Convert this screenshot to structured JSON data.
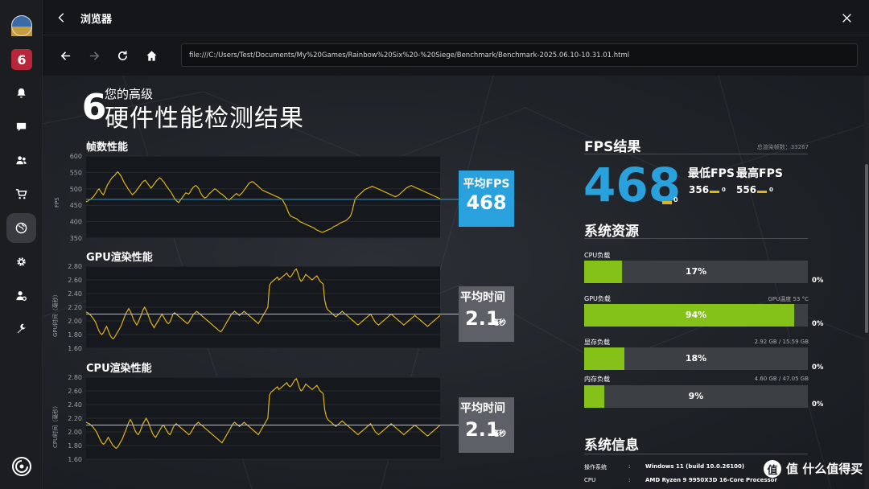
{
  "window": {
    "title": "浏览器",
    "url": "file:///C:/Users/Test/Documents/My%20Games/Rainbow%20Six%20-%20Siege/Benchmark/Benchmark-2025.06.10-10.31.01.html"
  },
  "sidebar": {
    "items": [
      {
        "name": "avatar"
      },
      {
        "name": "game-r6-icon"
      },
      {
        "name": "bell-icon"
      },
      {
        "name": "chat-icon"
      },
      {
        "name": "friends-icon"
      },
      {
        "name": "cart-icon"
      },
      {
        "name": "globe-icon"
      },
      {
        "name": "gear-icon"
      },
      {
        "name": "user-settings-icon"
      },
      {
        "name": "wrench-icon"
      },
      {
        "name": "ubisoft-icon"
      }
    ]
  },
  "report": {
    "logo_glyph": "6",
    "subtitle": "您的高级",
    "title": "硬件性能检测结果",
    "watermark": "值 什么值得买"
  },
  "fps_chart": {
    "title": "帧数性能",
    "ylabel": "FPS",
    "badge_label": "平均FPS",
    "badge_value": "468"
  },
  "gpu_chart": {
    "title": "GPU渲染性能",
    "ylabel": "GPU时间（毫秒）",
    "badge_label": "平均时间",
    "badge_value": "2.1",
    "badge_unit": "毫秒"
  },
  "cpu_chart": {
    "title": "CPU渲染性能",
    "ylabel": "CPU时间（毫秒）",
    "badge_label": "平均时间",
    "badge_value": "2.1",
    "badge_unit": "毫秒"
  },
  "fps_result": {
    "title": "FPS结果",
    "total_frames": "总渲染帧数：33267",
    "avg": "468",
    "avg_sub": "0",
    "min_label": "最低FPS",
    "max_label": "最高FPS",
    "min": "356",
    "min_sub": "0",
    "max": "556",
    "max_sub": "0"
  },
  "resources": {
    "title": "系统资源",
    "items": [
      {
        "label": "CPU负载",
        "value": "17%",
        "extra": "",
        "zero": "0%",
        "fraction": 0.17
      },
      {
        "label": "GPU负载",
        "value": "94%",
        "extra": "GPU温度 53 °C",
        "zero": "0%",
        "fraction": 0.94
      },
      {
        "label": "显存负载",
        "value": "18%",
        "extra": "2.92 GB / 15.59 GB",
        "zero": "0%",
        "fraction": 0.18
      },
      {
        "label": "内存负载",
        "value": "9%",
        "extra": "4.60 GB / 47.05 GB",
        "zero": "0%",
        "fraction": 0.09
      }
    ]
  },
  "sysinfo": {
    "title": "系统信息",
    "rows": [
      {
        "key": "操作系统",
        "sep": ":",
        "value": "Windows 11 (build 10.0.26100)"
      },
      {
        "key": "CPU",
        "sep": ":",
        "value": "AMD Ryzen 9 9950X3D 16-Core Processor"
      }
    ]
  },
  "colors": {
    "accent_blue": "#29a1dd",
    "accent_green": "#84c21a",
    "series_yellow": "#e0b415",
    "badge_grey": "#5d6066"
  },
  "chart_data": [
    {
      "type": "line",
      "title": "帧数性能",
      "ylabel": "FPS",
      "ylim": [
        350,
        600
      ],
      "yticks": [
        "600",
        "550",
        "500",
        "450",
        "400",
        "350"
      ],
      "reference_line": 468,
      "series": [
        {
          "name": "",
          "values": [
            460,
            462,
            466,
            468,
            472,
            476,
            482,
            488,
            496,
            500,
            492,
            486,
            482,
            492,
            504,
            514,
            520,
            528,
            534,
            538,
            542,
            548,
            552,
            546,
            540,
            532,
            522,
            514,
            508,
            500,
            494,
            488,
            482,
            486,
            490,
            496,
            502,
            508,
            514,
            520,
            524,
            526,
            520,
            514,
            508,
            502,
            508,
            514,
            520,
            526,
            530,
            534,
            530,
            524,
            520,
            512,
            506,
            500,
            494,
            488,
            480,
            472,
            466,
            462,
            458,
            464,
            470,
            476,
            482,
            488,
            486,
            484,
            490,
            498,
            504,
            508,
            510,
            506,
            500,
            490,
            482,
            476,
            472,
            474,
            478,
            484,
            488,
            492,
            496,
            500,
            498,
            494,
            490,
            486,
            484,
            480,
            476,
            472,
            468,
            466,
            470,
            474,
            478,
            482,
            486,
            482,
            480,
            484,
            488,
            494,
            500,
            506,
            512,
            518,
            520,
            522,
            520,
            516,
            512,
            508,
            504,
            500,
            496,
            494,
            492,
            490,
            488,
            486,
            484,
            482,
            480,
            478,
            476,
            474,
            472,
            470,
            466,
            458,
            450,
            440,
            428,
            420,
            416,
            414,
            412,
            410,
            408,
            404,
            400,
            398,
            396,
            394,
            392,
            390,
            388,
            386,
            384,
            382,
            380,
            376,
            374,
            372,
            370,
            368,
            368,
            370,
            372,
            374,
            376,
            378,
            380,
            384,
            386,
            388,
            390,
            394,
            396,
            398,
            400,
            402,
            404,
            408,
            412,
            418,
            430,
            448,
            466,
            474,
            478,
            482,
            486,
            490,
            494,
            498,
            500,
            502,
            504,
            506,
            508,
            506,
            504,
            502,
            500,
            498,
            496,
            494,
            492,
            490,
            488,
            486,
            484,
            482,
            480,
            478,
            476,
            478,
            480,
            484,
            488,
            492,
            496,
            500,
            504,
            506,
            508,
            510,
            508,
            506,
            504,
            502,
            500,
            498,
            496,
            494,
            492,
            490,
            488,
            486,
            484,
            482,
            480,
            478,
            476,
            474,
            472,
            470
          ]
        }
      ]
    },
    {
      "type": "line",
      "title": "GPU渲染性能",
      "ylabel": "GPU时间（毫秒）",
      "ylim": [
        1.6,
        2.8
      ],
      "yticks": [
        "2.80",
        "2.60",
        "2.40",
        "2.20",
        "2.00",
        "1.80",
        "1.60"
      ],
      "reference_line": 2.1,
      "series": [
        {
          "name": "",
          "values": [
            2.13,
            2.12,
            2.1,
            2.08,
            2.05,
            2.02,
            1.98,
            1.92,
            1.86,
            1.82,
            1.8,
            1.83,
            1.88,
            1.92,
            1.86,
            1.8,
            1.76,
            1.74,
            1.76,
            1.8,
            1.84,
            1.88,
            1.92,
            1.98,
            2.04,
            2.1,
            2.14,
            2.18,
            2.14,
            2.08,
            2.02,
            1.98,
            1.94,
            1.98,
            2.04,
            2.1,
            2.16,
            2.2,
            2.16,
            2.1,
            2.04,
            1.98,
            1.94,
            1.9,
            1.94,
            1.98,
            2.02,
            2.06,
            2.1,
            2.06,
            2.02,
            1.98,
            1.96,
            1.98,
            2.04,
            2.1,
            2.12,
            2.1,
            2.08,
            2.06,
            2.04,
            2.02,
            2.0,
            1.98,
            1.96,
            1.98,
            2.02,
            2.06,
            2.1,
            2.12,
            2.14,
            2.12,
            2.1,
            2.08,
            2.06,
            2.04,
            2.02,
            2.0,
            1.98,
            1.96,
            1.94,
            1.92,
            1.9,
            1.88,
            1.86,
            1.84,
            1.86,
            1.9,
            1.94,
            1.98,
            2.02,
            2.06,
            2.1,
            2.12,
            2.14,
            2.12,
            2.1,
            2.08,
            2.1,
            2.12,
            2.14,
            2.12,
            2.1,
            2.08,
            2.06,
            2.04,
            2.02,
            2.0,
            1.98,
            1.96,
            2.0,
            2.04,
            2.08,
            2.12,
            2.16,
            2.2,
            2.52,
            2.56,
            2.58,
            2.6,
            2.62,
            2.64,
            2.6,
            2.62,
            2.64,
            2.66,
            2.68,
            2.7,
            2.66,
            2.64,
            2.66,
            2.7,
            2.74,
            2.76,
            2.7,
            2.62,
            2.58,
            2.6,
            2.64,
            2.68,
            2.66,
            2.64,
            2.62,
            2.6,
            2.62,
            2.64,
            2.66,
            2.62,
            2.58,
            2.56,
            2.54,
            2.3,
            2.2,
            2.16,
            2.14,
            2.12,
            2.1,
            2.08,
            2.06,
            2.08,
            2.1,
            2.12,
            2.14,
            2.12,
            2.1,
            2.08,
            2.06,
            2.04,
            2.02,
            2.0,
            1.98,
            1.96,
            1.94,
            1.96,
            1.98,
            2.0,
            2.02,
            2.04,
            2.06,
            2.08,
            2.1,
            2.06,
            2.02,
            1.98,
            1.96,
            1.94,
            1.96,
            1.98,
            2.0,
            2.02,
            2.04,
            2.06,
            2.08,
            2.1,
            2.08,
            2.06,
            2.04,
            2.02,
            2.0,
            1.98,
            1.96,
            1.94,
            1.96,
            1.98,
            2.0,
            2.02,
            2.04,
            2.06,
            2.08,
            2.06,
            2.04,
            2.02,
            2.0,
            1.98,
            1.96,
            1.94,
            1.92,
            1.94,
            1.96,
            1.98,
            2.0,
            2.02,
            2.04,
            2.06,
            2.08
          ]
        }
      ]
    },
    {
      "type": "line",
      "title": "CPU渲染性能",
      "ylabel": "CPU时间（毫秒）",
      "ylim": [
        1.6,
        2.8
      ],
      "yticks": [
        "2.80",
        "2.60",
        "2.40",
        "2.20",
        "2.00",
        "1.80",
        "1.60"
      ],
      "reference_line": 2.1,
      "series": [
        {
          "name": "",
          "values": [
            2.14,
            2.13,
            2.12,
            2.1,
            2.08,
            2.05,
            2.02,
            1.98,
            1.93,
            1.88,
            1.84,
            1.82,
            1.84,
            1.88,
            1.92,
            1.88,
            1.84,
            1.8,
            1.78,
            1.76,
            1.78,
            1.82,
            1.86,
            1.9,
            1.96,
            2.02,
            2.08,
            2.14,
            2.18,
            2.14,
            2.08,
            2.02,
            1.98,
            1.96,
            2.0,
            2.06,
            2.12,
            2.16,
            2.2,
            2.16,
            2.1,
            2.04,
            1.98,
            1.94,
            1.92,
            1.96,
            2.0,
            2.04,
            2.08,
            2.1,
            2.06,
            2.02,
            1.98,
            1.96,
            2.0,
            2.06,
            2.1,
            2.12,
            2.1,
            2.08,
            2.06,
            2.04,
            2.02,
            2.0,
            1.98,
            1.96,
            1.98,
            2.02,
            2.06,
            2.1,
            2.12,
            2.14,
            2.12,
            2.1,
            2.08,
            2.06,
            2.04,
            2.02,
            2.0,
            1.98,
            1.96,
            1.94,
            1.92,
            1.9,
            1.88,
            1.86,
            1.84,
            1.88,
            1.92,
            1.96,
            2.0,
            2.04,
            2.08,
            2.12,
            2.14,
            2.12,
            2.1,
            2.08,
            2.1,
            2.12,
            2.14,
            2.12,
            2.1,
            2.08,
            2.06,
            2.04,
            2.02,
            2.0,
            1.98,
            1.96,
            2.0,
            2.04,
            2.08,
            2.12,
            2.16,
            2.2,
            2.54,
            2.58,
            2.6,
            2.62,
            2.64,
            2.66,
            2.62,
            2.64,
            2.66,
            2.68,
            2.7,
            2.72,
            2.68,
            2.66,
            2.68,
            2.72,
            2.76,
            2.78,
            2.72,
            2.64,
            2.6,
            2.62,
            2.66,
            2.7,
            2.68,
            2.66,
            2.64,
            2.62,
            2.64,
            2.66,
            2.68,
            2.64,
            2.6,
            2.58,
            2.56,
            2.32,
            2.22,
            2.18,
            2.16,
            2.14,
            2.12,
            2.1,
            2.08,
            2.1,
            2.12,
            2.14,
            2.16,
            2.14,
            2.12,
            2.1,
            2.08,
            2.06,
            2.04,
            2.02,
            2.0,
            1.98,
            1.96,
            1.98,
            2.0,
            2.02,
            2.04,
            2.06,
            2.08,
            2.1,
            2.12,
            2.08,
            2.04,
            2.0,
            1.98,
            1.96,
            1.98,
            2.0,
            2.02,
            2.04,
            2.06,
            2.08,
            2.1,
            2.12,
            2.1,
            2.08,
            2.06,
            2.04,
            2.02,
            2.0,
            1.98,
            1.96,
            1.98,
            2.0,
            2.02,
            2.04,
            2.06,
            2.08,
            2.1,
            2.08,
            2.06,
            2.04,
            2.02,
            2.0,
            1.98,
            1.96,
            1.94,
            1.96,
            1.98,
            2.0,
            2.02,
            2.04,
            2.06,
            2.08,
            2.1
          ]
        }
      ]
    }
  ]
}
